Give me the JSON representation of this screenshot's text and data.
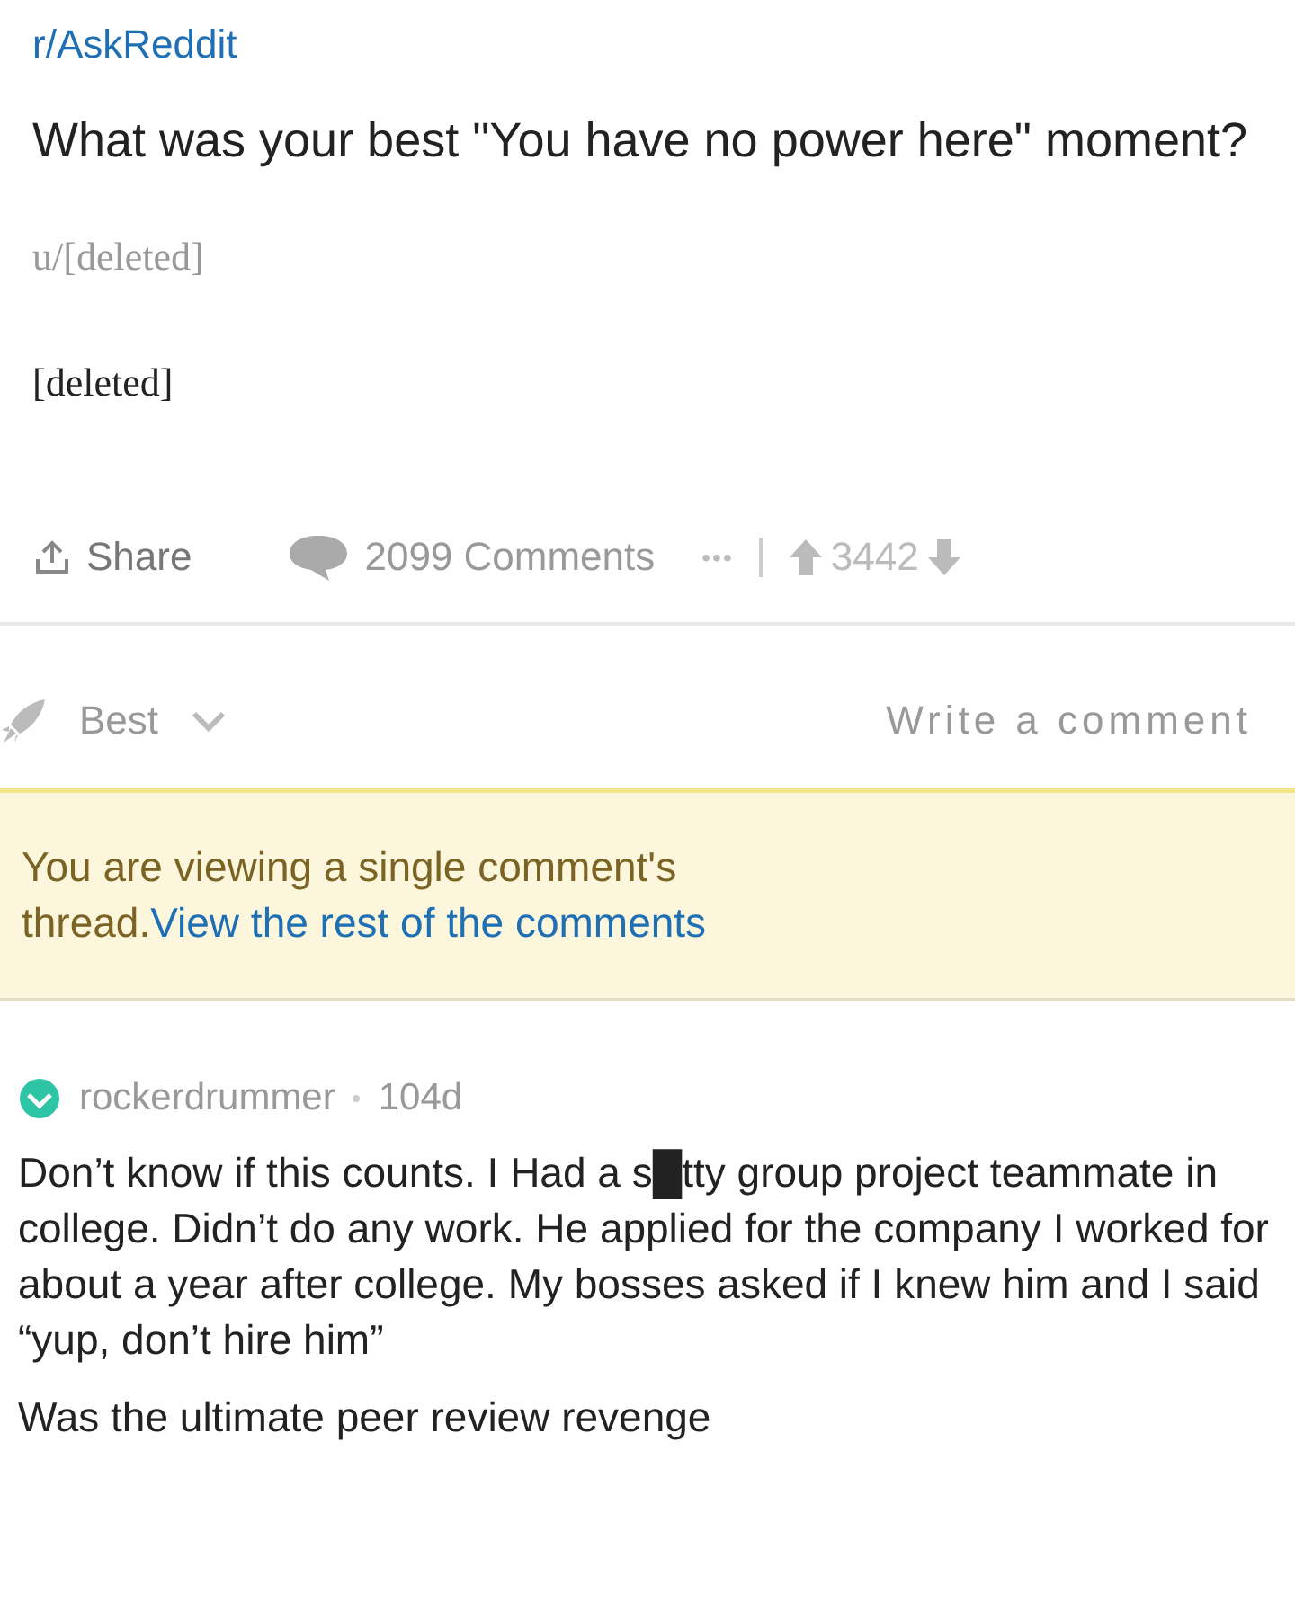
{
  "post": {
    "subreddit": "r/AskReddit",
    "title": "What was your best \"You have no power here\" moment?",
    "author": "u/[deleted]",
    "body": "[deleted]"
  },
  "actions": {
    "share": "Share",
    "comments": "2099 Comments",
    "more": "•••",
    "score": "3442"
  },
  "sort": {
    "label": "Best",
    "write": "Write a comment"
  },
  "banner": {
    "text": "You are viewing a single comment's thread.",
    "link": "View the rest of the comments"
  },
  "comment": {
    "user": "rockerdrummer",
    "verified": true,
    "age": "104d",
    "paragraphs": [
      "Don’t know if this counts. I Had a s█tty group project teammate in college. Didn’t do any work. He applied for the company I worked for about a year after college. My bosses asked if I knew him and I said “yup, don’t hire him”",
      "Was the ultimate peer review revenge"
    ]
  }
}
